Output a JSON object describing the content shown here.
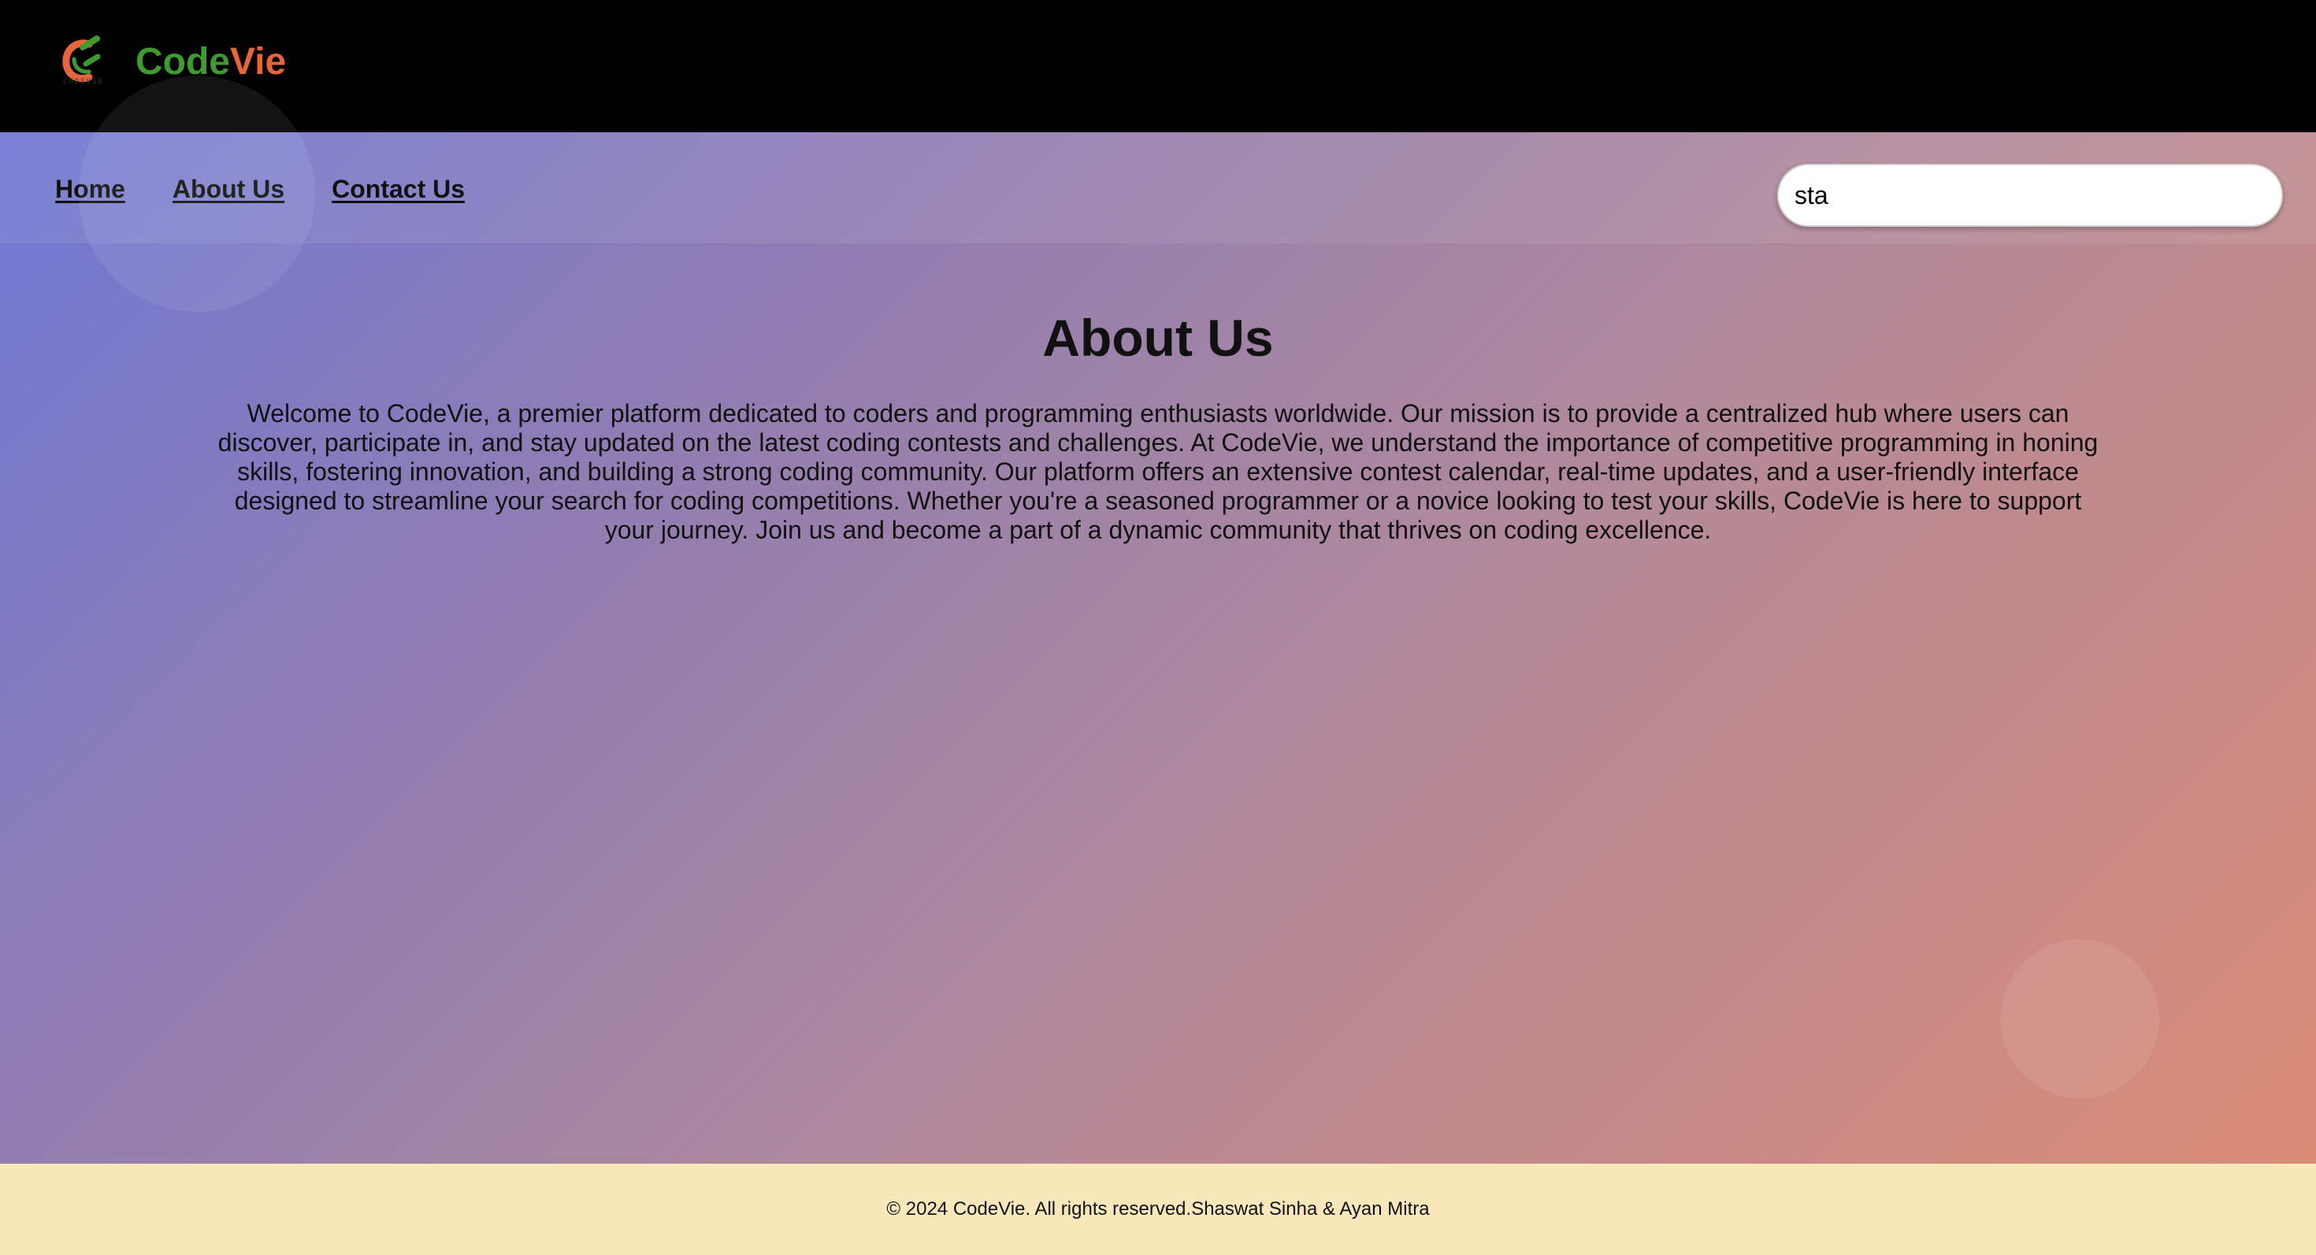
{
  "colors": {
    "header_background": "#000000",
    "brand_code": "#3f9a2f",
    "brand_vie": "#e8643a",
    "gradient_start": "#6c76d8",
    "gradient_end": "#dc8b74",
    "footer_background": "#f9e8bc"
  },
  "header": {
    "logo_icon": "codevie-logo-icon",
    "logo_small_text": "CODEVIE",
    "brand_code": "Code",
    "brand_vie": "Vie"
  },
  "nav": {
    "home": "Home",
    "about": "About Us",
    "contact": "Contact Us"
  },
  "search": {
    "value": "sta"
  },
  "main": {
    "title": "About Us",
    "paragraph": "Welcome to CodeVie, a premier platform dedicated to coders and programming enthusiasts worldwide. Our mission is to provide a centralized hub where users can discover, participate in, and stay updated on the latest coding contests and challenges. At CodeVie, we understand the importance of competitive programming in honing skills, fostering innovation, and building a strong coding community. Our platform offers an extensive contest calendar, real-time updates, and a user-friendly interface designed to streamline your search for coding competitions. Whether you're a seasoned programmer or a novice looking to test your skills, CodeVie is here to support your journey. Join us and become a part of a dynamic community that thrives on coding excellence."
  },
  "footer": {
    "text": "© 2024 CodeVie. All rights reserved.Shaswat Sinha & Ayan Mitra"
  }
}
